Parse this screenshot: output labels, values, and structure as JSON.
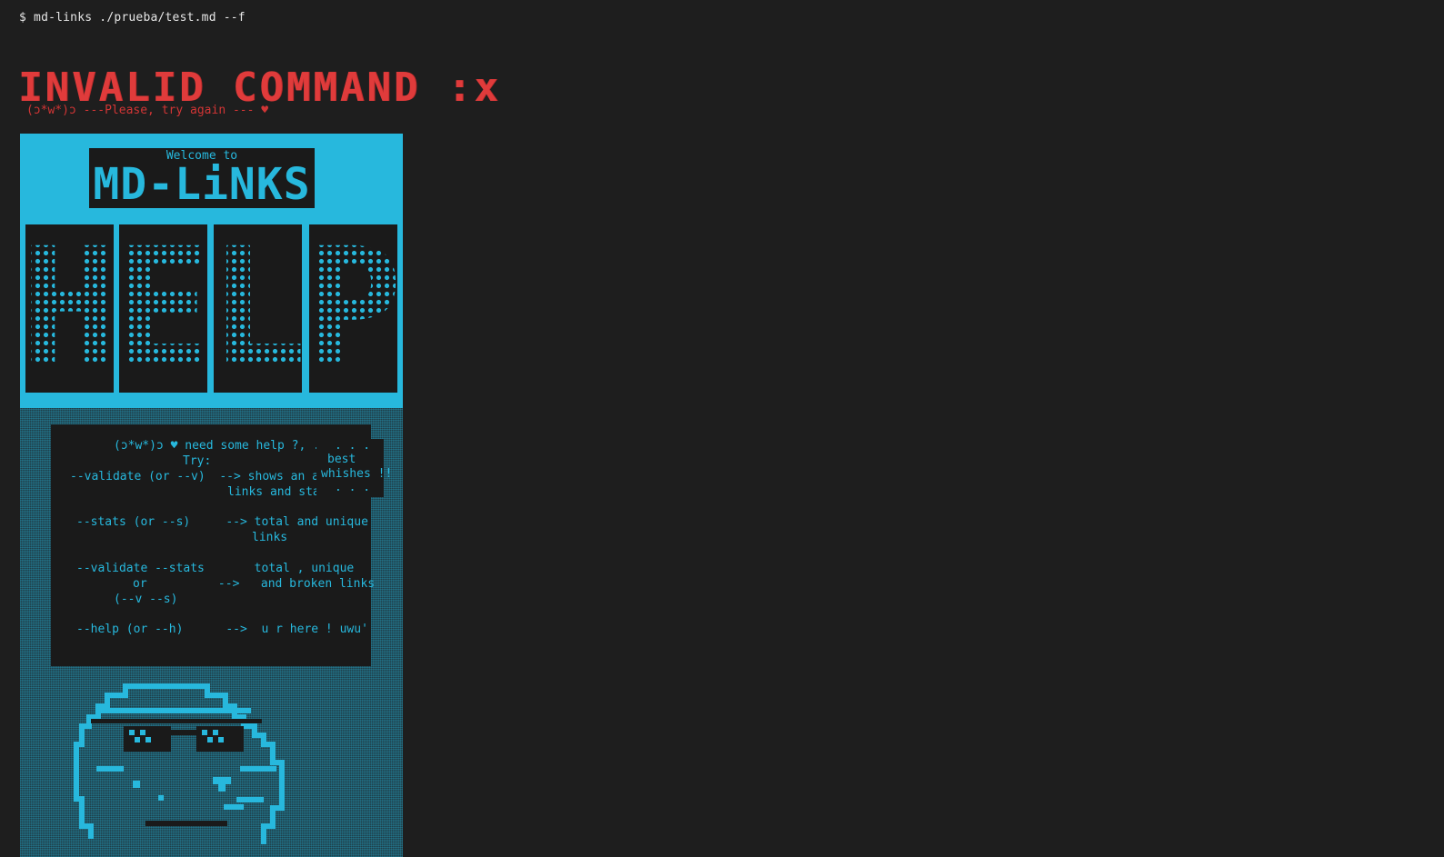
{
  "terminal": {
    "prompt_command": "$ md-links ./prueba/test.md --f",
    "error_title": "INVALID COMMAND :x",
    "error_subtitle": "(ɔ*w*)ɔ ---Please, try again --- ♥"
  },
  "banner": {
    "welcome": "Welcome to",
    "brand": "MD-LiNKS",
    "help_letters": [
      "H",
      "E",
      "L",
      "P"
    ]
  },
  "help": {
    "lines": [
      "(ɔ*w*)ɔ ♥ need some help ?, ...",
      "Try:",
      "--validate (or --v)  --> shows an array with",
      "links and status",
      "--stats (or --s)     --> total and unique",
      "links",
      "--validate --stats       total , unique",
      "or          -->   and broken links",
      "(--v --s)",
      "--help (or --h)      -->  u r here ! uwu'"
    ]
  },
  "bubble": {
    "dots_top": ". . .",
    "line1": "best",
    "line2": "whishes !!",
    "dots_bottom": ". . ."
  },
  "colors": {
    "background": "#1e1e1e",
    "accent": "#27b8dd",
    "error": "#e03b3b"
  }
}
